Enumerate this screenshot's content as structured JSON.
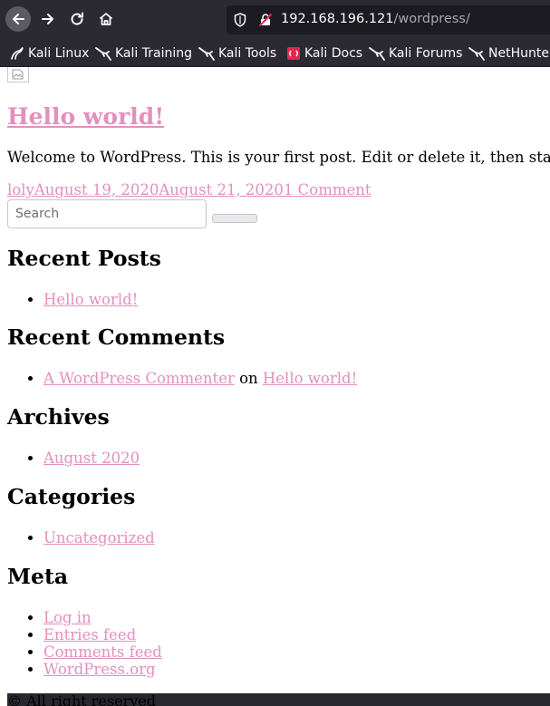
{
  "browser": {
    "url_host": "192.168.196.121",
    "url_path": "/wordpress/",
    "bookmarks": [
      {
        "label": "Kali Linux",
        "icon": "kali-dragon-icon"
      },
      {
        "label": "Kali Training",
        "icon": "kali-dragon-icon"
      },
      {
        "label": "Kali Tools",
        "icon": "kali-dragon-icon"
      },
      {
        "label": "Kali Docs",
        "icon": "kali-docs-icon"
      },
      {
        "label": "Kali Forums",
        "icon": "kali-dragon-icon"
      },
      {
        "label": "NetHunter",
        "icon": "kali-dragon-icon"
      }
    ]
  },
  "post": {
    "title": "Hello world!",
    "excerpt": "Welcome to WordPress. This is your first post. Edit or delete it, then start",
    "author": "loly",
    "published": "August 19, 2020",
    "updated": "August 21, 2020",
    "comments": "1 Comment"
  },
  "search": {
    "placeholder": "Search"
  },
  "widgets": {
    "recent_posts": {
      "title": "Recent Posts",
      "items": [
        "Hello world!"
      ]
    },
    "recent_comments": {
      "title": "Recent Comments",
      "commenter": "A WordPress Commenter",
      "connector": "on",
      "post": "Hello world!"
    },
    "archives": {
      "title": "Archives",
      "items": [
        "August 2020"
      ]
    },
    "categories": {
      "title": "Categories",
      "items": [
        "Uncategorized"
      ]
    },
    "meta": {
      "title": "Meta",
      "items": [
        "Log in",
        "Entries feed",
        "Comments feed",
        "WordPress.org"
      ]
    }
  },
  "footer": {
    "text": "© All right reserved"
  },
  "colors": {
    "link": "#e48fbf",
    "chrome_bg": "#2b2a33",
    "urlbar_bg": "#1c1b22"
  }
}
